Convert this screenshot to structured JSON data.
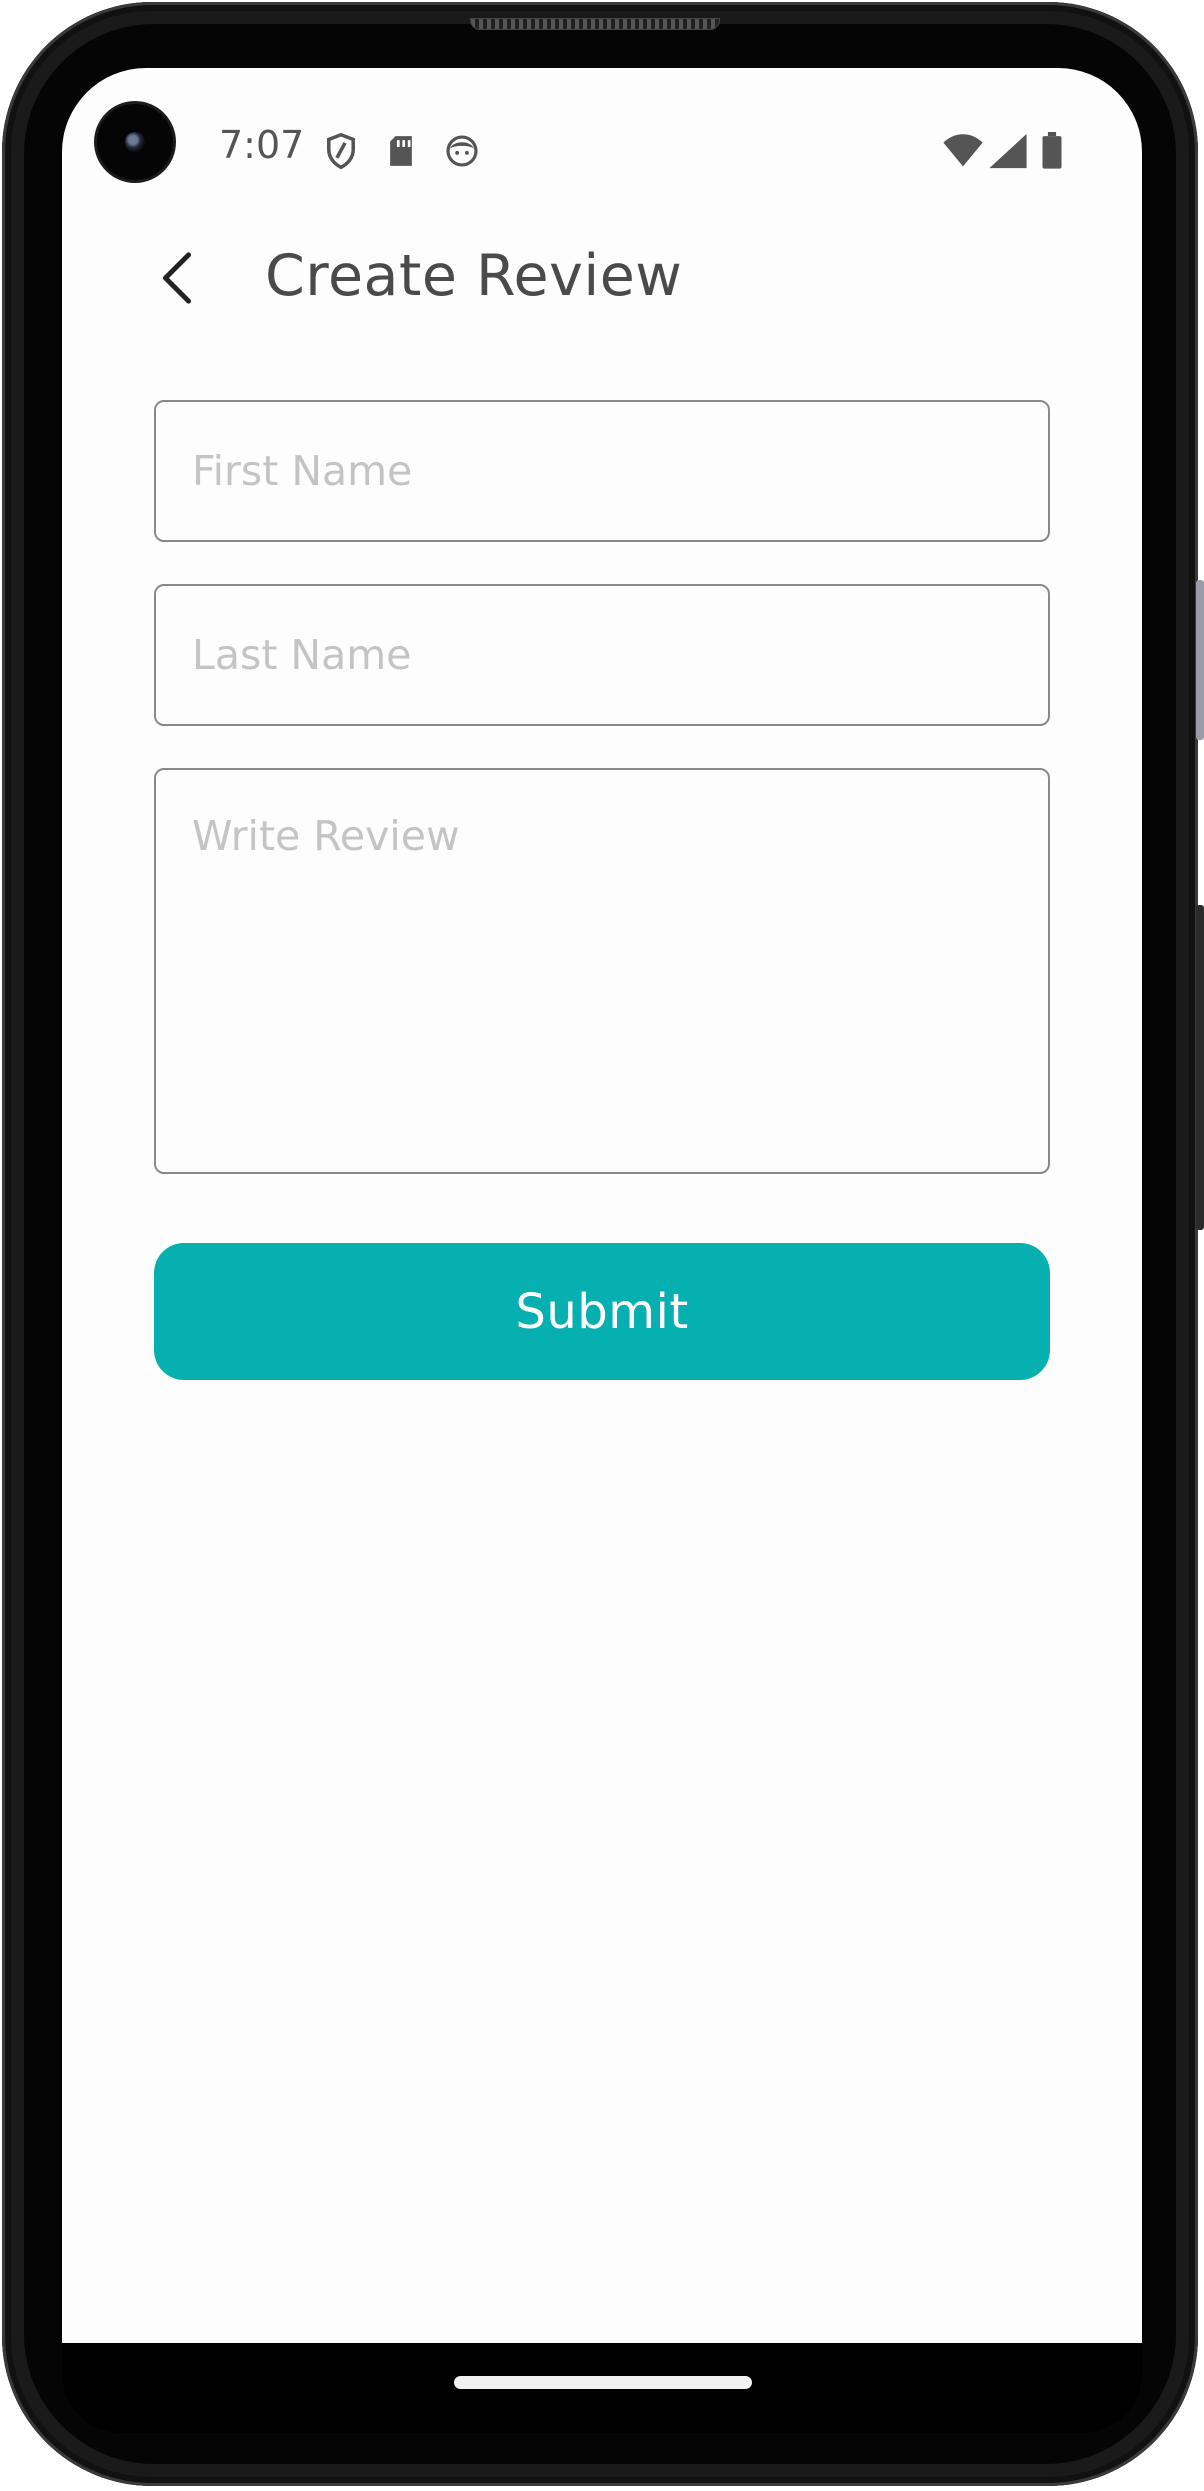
{
  "status_bar": {
    "time": "7:07",
    "icons": [
      "shield-icon",
      "sd-card-icon",
      "face-icon",
      "wifi-icon",
      "cellular-signal-icon",
      "battery-icon"
    ]
  },
  "app_bar": {
    "back_icon": "chevron-left-icon",
    "title": "Create Review"
  },
  "form": {
    "first_name_placeholder": "First Name",
    "first_name_value": "",
    "last_name_placeholder": "Last Name",
    "last_name_value": "",
    "review_placeholder": "Write Review",
    "review_value": "",
    "submit_label": "Submit"
  },
  "colors": {
    "accent": "#07b0b0",
    "title_text": "#4a4a4a",
    "placeholder_text": "#c4c4c4",
    "field_border": "#8a8a8a",
    "status_icons": "#555555"
  }
}
